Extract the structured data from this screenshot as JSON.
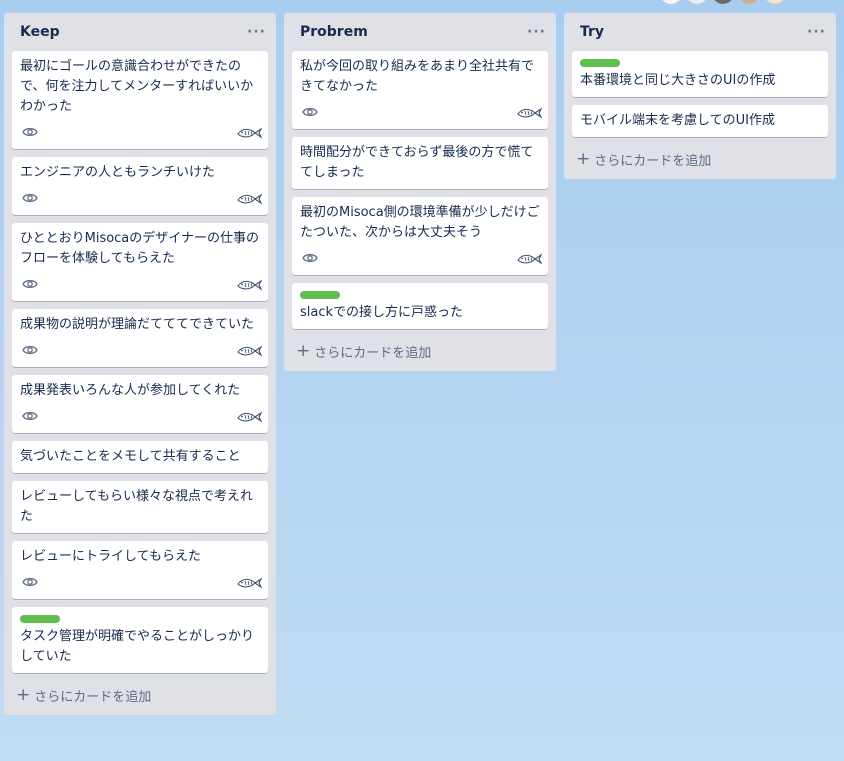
{
  "board": {
    "lists": [
      {
        "title": "Keep",
        "menu": "···",
        "add_card": "さらにカードを追加",
        "cards": [
          {
            "text": "最初にゴールの意識合わせができたので、何を注力してメンターすればいいかわかった",
            "label": false,
            "eye": true,
            "fish": true
          },
          {
            "text": "エンジニアの人ともランチいけた",
            "label": false,
            "eye": true,
            "fish": true
          },
          {
            "text": "ひととおりMisocaのデザイナーの仕事のフローを体験してもらえた",
            "label": false,
            "eye": true,
            "fish": true
          },
          {
            "text": "成果物の説明が理論だてててできていた",
            "label": false,
            "eye": true,
            "fish": true
          },
          {
            "text": "成果発表いろんな人が参加してくれた",
            "label": false,
            "eye": true,
            "fish": true
          },
          {
            "text": "気づいたことをメモして共有すること",
            "label": false,
            "eye": false,
            "fish": false
          },
          {
            "text": "レビューしてもらい様々な視点で考えれた",
            "label": false,
            "eye": false,
            "fish": false
          },
          {
            "text": "レビューにトライしてもらえた",
            "label": false,
            "eye": true,
            "fish": true
          },
          {
            "text": "タスク管理が明確でやることがしっかりしていた",
            "label": true,
            "eye": false,
            "fish": false
          }
        ]
      },
      {
        "title": "Probrem",
        "menu": "···",
        "add_card": "さらにカードを追加",
        "cards": [
          {
            "text": "私が今回の取り組みをあまり全社共有できてなかった",
            "label": false,
            "eye": true,
            "fish": true
          },
          {
            "text": "時間配分ができておらず最後の方で慌ててしまった",
            "label": false,
            "eye": false,
            "fish": false
          },
          {
            "text": "最初のMisoca側の環境準備が少しだけごたついた、次からは大丈夫そう",
            "label": false,
            "eye": true,
            "fish": true
          },
          {
            "text": "slackでの接し方に戸惑った",
            "label": true,
            "eye": false,
            "fish": false
          }
        ]
      },
      {
        "title": "Try",
        "menu": "···",
        "add_card": "さらにカードを追加",
        "cards": [
          {
            "text": "本番環境と同じ大きさのUIの作成",
            "label": true,
            "eye": false,
            "fish": false
          },
          {
            "text": "モバイル端末を考慮してのUI作成",
            "label": false,
            "eye": false,
            "fish": false
          }
        ]
      }
    ]
  },
  "colors": {
    "label_green": "#61bd4f",
    "list_bg": "#dfe1e6",
    "board_bg": "#b7d6f1"
  },
  "icons": {
    "eye": "eye-icon",
    "fish": "fish-sticker-icon",
    "plus": "plus-icon",
    "menu": "ellipsis-icon"
  }
}
